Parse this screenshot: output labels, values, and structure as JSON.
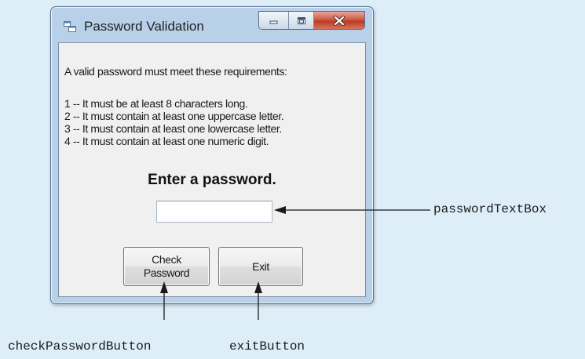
{
  "window": {
    "title": "Password Validation",
    "controls": {
      "minimize": "minimize",
      "maximize": "maximize",
      "close": "close"
    }
  },
  "requirements": {
    "intro": "A valid password must meet these requirements:",
    "items": [
      "1 -- It must be at least 8 characters long.",
      "2 -- It must contain at least one uppercase letter.",
      "3 -- It must contain at least one lowercase letter.",
      "4 -- It must contain at least one numeric digit."
    ]
  },
  "prompt": "Enter a password.",
  "password_input": {
    "value": "",
    "placeholder": ""
  },
  "buttons": {
    "check_password": "Check Password",
    "exit": "Exit"
  },
  "callouts": {
    "password_textbox": "passwordTextBox",
    "check_password_button": "checkPasswordButton",
    "exit_button": "exitButton"
  },
  "colors": {
    "background": "#ddeef9",
    "window_frame": "#b8d1e8",
    "close_button": "#c9452e",
    "client_area": "#f0f0f0"
  },
  "icons": [
    "app-form-icon",
    "minimize-icon",
    "maximize-icon",
    "close-icon",
    "arrow-icon"
  ]
}
